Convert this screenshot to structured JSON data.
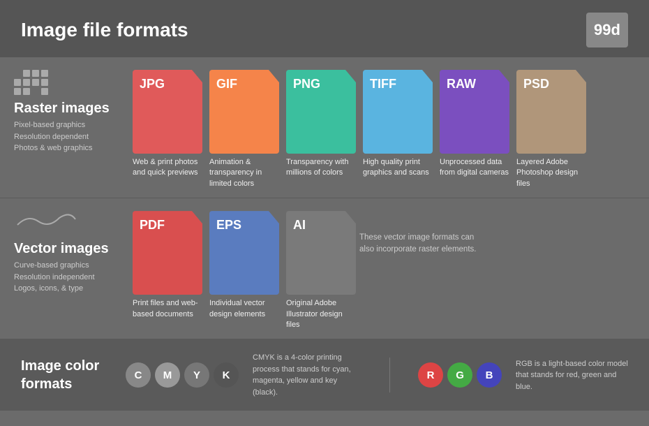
{
  "header": {
    "title": "Image file formats",
    "logo": "99d"
  },
  "raster": {
    "section_title": "Raster images",
    "description_lines": [
      "Pixel-based graphics",
      "Resolution dependent",
      "Photos & web graphics"
    ],
    "formats": [
      {
        "id": "jpg",
        "label": "JPG",
        "color_class": "jpg-color",
        "desc": "Web & print photos and quick previews"
      },
      {
        "id": "gif",
        "label": "GIF",
        "color_class": "gif-color",
        "desc": "Animation & transparency in limited colors"
      },
      {
        "id": "png",
        "label": "PNG",
        "color_class": "png-color",
        "desc": "Transparency with millions of colors"
      },
      {
        "id": "tiff",
        "label": "TIFF",
        "color_class": "tiff-color",
        "desc": "High quality print graphics and scans"
      },
      {
        "id": "raw",
        "label": "RAW",
        "color_class": "raw-color",
        "desc": "Unprocessed data from digital cameras"
      },
      {
        "id": "psd",
        "label": "PSD",
        "color_class": "psd-color",
        "desc": "Layered Adobe Photoshop design files"
      }
    ]
  },
  "vector": {
    "section_title": "Vector images",
    "description_lines": [
      "Curve-based graphics",
      "Resolution independent",
      "Logos, icons, & type"
    ],
    "formats": [
      {
        "id": "pdf",
        "label": "PDF",
        "color_class": "pdf-color",
        "desc": "Print files and web-based documents"
      },
      {
        "id": "eps",
        "label": "EPS",
        "color_class": "eps-color",
        "desc": "Individual vector design elements"
      },
      {
        "id": "ai",
        "label": "AI",
        "color_class": "ai-color",
        "desc": "Original Adobe Illustrator design files"
      }
    ],
    "note": "These vector image formats can also incorporate raster elements."
  },
  "color_formats": {
    "title": "Image color formats",
    "cmyk": {
      "letters": [
        "C",
        "M",
        "Y",
        "K"
      ],
      "desc": "CMYK is a 4-color printing process that stands for cyan, magenta, yellow and key (black)."
    },
    "rgb": {
      "letters": [
        "R",
        "G",
        "B"
      ],
      "desc": "RGB is a light-based color model that stands for red, green and blue."
    }
  }
}
